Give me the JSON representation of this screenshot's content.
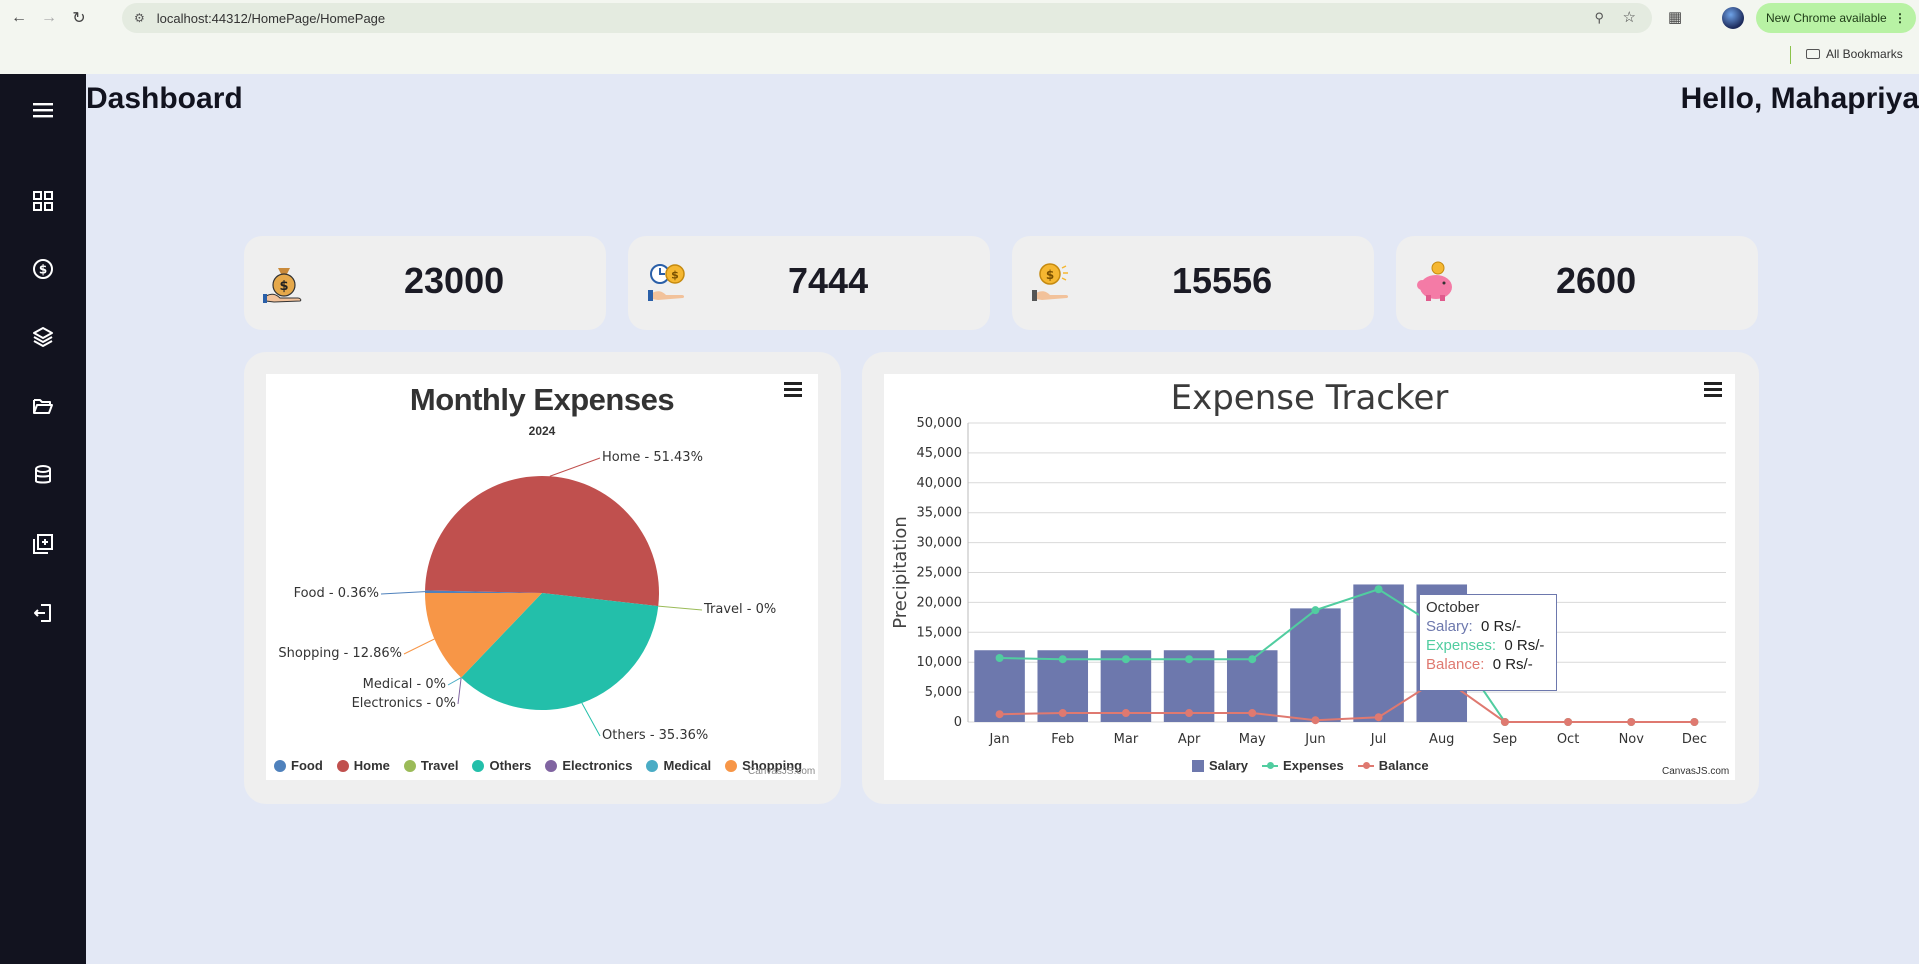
{
  "browser": {
    "url": "localhost:44312/HomePage/HomePage",
    "update_button": "New Chrome available",
    "bookmarks_label": "All Bookmarks"
  },
  "sidebar": {
    "items": [
      {
        "icon": "menu-icon"
      },
      {
        "icon": "dashboard-grid-icon"
      },
      {
        "icon": "dollar-circle-icon"
      },
      {
        "icon": "layers-icon"
      },
      {
        "icon": "folder-open-icon"
      },
      {
        "icon": "database-icon"
      },
      {
        "icon": "add-document-icon"
      },
      {
        "icon": "logout-icon"
      }
    ]
  },
  "header": {
    "title": "Dashboard",
    "greeting": "Hello, Mahapriya"
  },
  "stats": [
    {
      "icon": "money-bag-icon",
      "value": "23000"
    },
    {
      "icon": "clock-coin-icon",
      "value": "7444"
    },
    {
      "icon": "hand-coin-icon",
      "value": "15556"
    },
    {
      "icon": "piggy-bank-icon",
      "value": "2600"
    }
  ],
  "pie_chart": {
    "credit": "CanvasJS.com"
  },
  "line_chart": {
    "credit": "CanvasJS.com",
    "tooltip": {
      "title": "October",
      "rows": [
        {
          "label": "Salary:",
          "value": "0 Rs/-",
          "color": "#6d78ad"
        },
        {
          "label": "Expenses:",
          "value": "0 Rs/-",
          "color": "#51cda0"
        },
        {
          "label": "Balance:",
          "value": "0 Rs/-",
          "color": "#df7970"
        }
      ]
    }
  },
  "chart_data": [
    {
      "type": "pie",
      "title": "Monthly Expenses",
      "subtitle": "2024",
      "slices": [
        {
          "name": "Food",
          "label": "Food - 0.36%",
          "value": 0.36,
          "color": "#4f81bc"
        },
        {
          "name": "Home",
          "label": "Home - 51.43%",
          "value": 51.43,
          "color": "#c0504e"
        },
        {
          "name": "Travel",
          "label": "Travel - 0%",
          "value": 0,
          "color": "#9bbb58"
        },
        {
          "name": "Others",
          "label": "Others - 35.36%",
          "value": 35.36,
          "color": "#23bfaa"
        },
        {
          "name": "Electronics",
          "label": "Electronics - 0%",
          "value": 0,
          "color": "#8064a1"
        },
        {
          "name": "Medical",
          "label": "Medical - 0%",
          "value": 0,
          "color": "#4aacc5"
        },
        {
          "name": "Shopping",
          "label": "Shopping - 12.86%",
          "value": 12.86,
          "color": "#f79647"
        }
      ],
      "legend_placement": "bottom"
    },
    {
      "type": "bar",
      "title": "Expense Tracker",
      "ylabel": "Precipitation",
      "categories": [
        "Jan",
        "Feb",
        "Mar",
        "Apr",
        "May",
        "Jun",
        "Jul",
        "Aug",
        "Sep",
        "Oct",
        "Nov",
        "Dec"
      ],
      "ylim": [
        0,
        50000
      ],
      "yticks": [
        "0",
        "5,000",
        "10,000",
        "15,000",
        "20,000",
        "25,000",
        "30,000",
        "35,000",
        "40,000",
        "45,000",
        "50,000"
      ],
      "grid": true,
      "legend_placement": "bottom",
      "series": [
        {
          "name": "Salary",
          "kind": "column",
          "color": "#6d78ad",
          "values": [
            12000,
            12000,
            12000,
            12000,
            12000,
            19000,
            23000,
            23000,
            0,
            0,
            0,
            0
          ]
        },
        {
          "name": "Expenses",
          "kind": "line",
          "color": "#51cda0",
          "values": [
            10700,
            10500,
            10500,
            10500,
            10500,
            18700,
            22200,
            15500,
            0,
            0,
            0,
            0
          ]
        },
        {
          "name": "Balance",
          "kind": "line",
          "color": "#df7970",
          "values": [
            1300,
            1500,
            1500,
            1500,
            1500,
            300,
            800,
            7500,
            0,
            0,
            0,
            0
          ]
        }
      ]
    }
  ]
}
